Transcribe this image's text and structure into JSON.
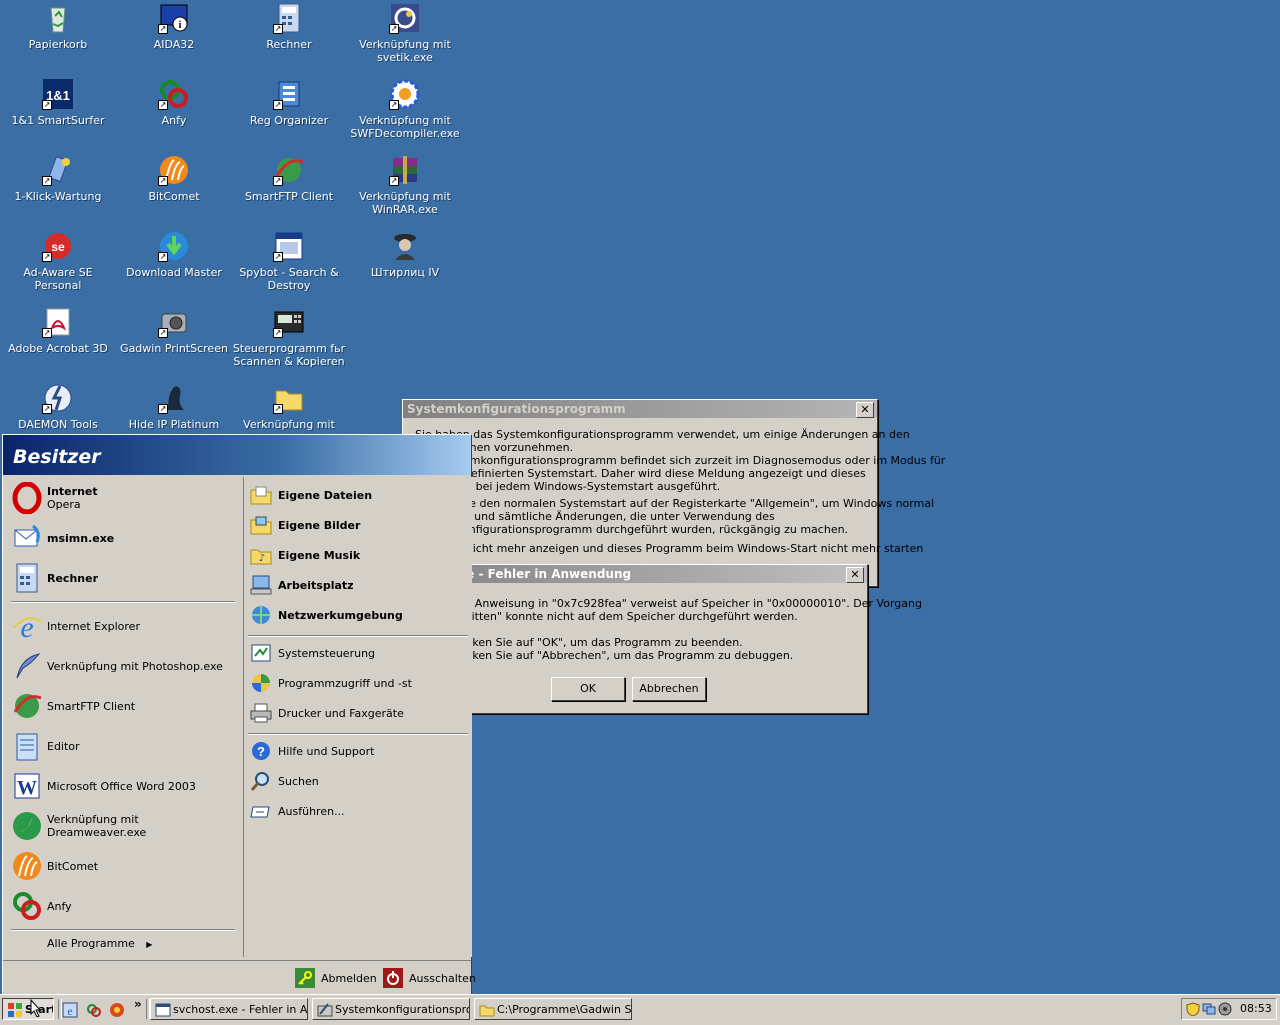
{
  "desktop": {
    "icons": [
      {
        "label": "Papierkorb",
        "icon": "recycle-bin-icon"
      },
      {
        "label": "AIDA32",
        "icon": "aida32-icon"
      },
      {
        "label": "Rechner",
        "icon": "calculator-icon"
      },
      {
        "label": "Verknüpfung mit svetik.exe",
        "icon": "svetik-icon"
      },
      {
        "label": "1&1 SmartSurfer",
        "icon": "smartsurfer-icon"
      },
      {
        "label": "Anfy",
        "icon": "anfy-icon"
      },
      {
        "label": "Reg Organizer",
        "icon": "reg-organizer-icon"
      },
      {
        "label": "Verknüpfung mit SWFDecompiler.exe",
        "icon": "swfdecompiler-icon"
      },
      {
        "label": "1-Klick-Wartung",
        "icon": "wartung-icon"
      },
      {
        "label": "BitComet",
        "icon": "bitcomet-icon"
      },
      {
        "label": "SmartFTP Client",
        "icon": "smartftp-icon"
      },
      {
        "label": "Verknüpfung mit WinRAR.exe",
        "icon": "winrar-icon"
      },
      {
        "label": "Ad-Aware SE Personal",
        "icon": "adaware-icon"
      },
      {
        "label": "Download Master",
        "icon": "download-master-icon"
      },
      {
        "label": "Spybot - Search & Destroy",
        "icon": "spybot-icon"
      },
      {
        "label": "Штирлиц IV",
        "icon": "shtirlitz-icon"
      },
      {
        "label": "Adobe Acrobat 3D",
        "icon": "acrobat-icon"
      },
      {
        "label": "Gadwin PrintScreen",
        "icon": "printscreen-icon"
      },
      {
        "label": "Steuerprogramm fьr Scannen & Kopieren",
        "icon": "scanner-icon"
      },
      {
        "label": "DAEMON Tools",
        "icon": "daemon-tools-icon"
      },
      {
        "label": "Hide IP Platinum",
        "icon": "hide-ip-icon"
      },
      {
        "label": "Verknüpfung mit",
        "icon": "folder-icon"
      }
    ]
  },
  "syskonfig": {
    "title": "Systemkonfigurationsprogramm",
    "line1": "Sie haben das Systemkonfigurationsprogramm verwendet, um einige Änderungen an den",
    "line2": "Startoptionen vorzunehmen.",
    "line3": "Das Systemkonfigurationsprogramm befindet sich zurzeit im Diagnosemodus oder im Modus für",
    "line4": "benutzerdefinierten Systemstart. Daher wird diese Meldung angezeigt und dieses",
    "line5": "Programm bei jedem Windows-Systemstart ausgeführt.",
    "line6": "Wählen Sie den normalen Systemstart auf der Registerkarte \"Allgemein\", um Windows normal",
    "line7": "zu starten und sämtliche Änderungen, die unter Verwendung des",
    "line8": "Systemkonfigurationsprogramm durchgeführt wurden, rückgängig zu machen.",
    "checkbox_label": "Meldung nicht mehr anzeigen und dieses Programm beim Windows-Start nicht mehr starten"
  },
  "error": {
    "title": "svchost.exe - Fehler in Anwendung",
    "line1": "Die Anweisung in \"0x7c928fea\" verweist auf Speicher in \"0x00000010\". Der Vorgang",
    "line2": "\"written\" konnte nicht auf dem Speicher durchgeführt werden.",
    "line3": "Klicken Sie auf \"OK\", um das Programm zu beenden.",
    "line4": "Klicken Sie auf \"Abbrechen\", um das Programm zu debuggen.",
    "ok": "OK",
    "cancel": "Abbrechen"
  },
  "startmenu": {
    "user": "Besitzer",
    "pinned": [
      {
        "title": "Internet",
        "sub": "Opera",
        "icon": "opera-icon"
      },
      {
        "title": "msimn.exe",
        "sub": "",
        "icon": "outlook-express-icon"
      },
      {
        "title": "Rechner",
        "sub": "",
        "icon": "calculator-icon"
      }
    ],
    "recent": [
      {
        "label": "Internet Explorer",
        "icon": "internet-explorer-icon"
      },
      {
        "label": "Verknüpfung mit Photoshop.exe",
        "icon": "photoshop-icon"
      },
      {
        "label": "SmartFTP Client",
        "icon": "smartftp-icon"
      },
      {
        "label": "Editor",
        "icon": "notepad-icon"
      },
      {
        "label": "Microsoft Office Word 2003",
        "icon": "word-icon"
      },
      {
        "label": "Verknüpfung mit Dreamweaver.exe",
        "icon": "dreamweaver-icon"
      },
      {
        "label": "BitComet",
        "icon": "bitcomet-icon"
      },
      {
        "label": "Anfy",
        "icon": "anfy-icon"
      }
    ],
    "all_programs": "Alle Programme",
    "right_top": [
      {
        "label": "Eigene Dateien",
        "icon": "my-documents-icon"
      },
      {
        "label": "Eigene Bilder",
        "icon": "my-pictures-icon"
      },
      {
        "label": "Eigene Musik",
        "icon": "my-music-icon"
      },
      {
        "label": "Arbeitsplatz",
        "icon": "my-computer-icon"
      },
      {
        "label": "Netzwerkumgebung",
        "icon": "network-icon"
      }
    ],
    "right_mid": [
      {
        "label": "Systemsteuerung",
        "icon": "control-panel-icon"
      },
      {
        "label": "Programmzugriff und -st",
        "icon": "program-access-icon"
      },
      {
        "label": "Drucker und Faxgeräte",
        "icon": "printer-icon"
      }
    ],
    "right_bottom": [
      {
        "label": "Hilfe und Support",
        "icon": "help-icon"
      },
      {
        "label": "Suchen",
        "icon": "search-icon"
      },
      {
        "label": "Ausführen...",
        "icon": "run-icon"
      }
    ],
    "logoff": "Abmelden",
    "shutdown": "Ausschalten"
  },
  "taskbar": {
    "start": "Start",
    "quicklaunch_more": "»",
    "tasks": [
      {
        "label": "svchost.exe - Fehler in A...",
        "icon": "window-icon"
      },
      {
        "label": "Systemkonfigurationspro...",
        "icon": "msconfig-icon"
      },
      {
        "label": "C:\\Programme\\Gadwin S...",
        "icon": "folder-icon"
      }
    ],
    "clock": "08:53"
  },
  "colors": {
    "desktop": "#3a6ea5",
    "face": "#d4d0c8",
    "error": "#d40000"
  }
}
